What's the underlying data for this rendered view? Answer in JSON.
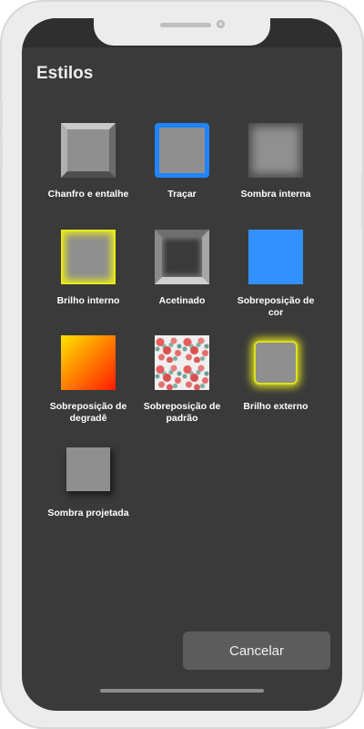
{
  "header": {
    "title": "Estilos"
  },
  "styles": [
    {
      "label": "Chanfro e entalhe"
    },
    {
      "label": "Traçar"
    },
    {
      "label": "Sombra interna"
    },
    {
      "label": "Brilho interno"
    },
    {
      "label": "Acetinado"
    },
    {
      "label": "Sobreposição de cor"
    },
    {
      "label": "Sobreposição de degradê"
    },
    {
      "label": "Sobreposição de padrão"
    },
    {
      "label": "Brilho externo"
    },
    {
      "label": "Sombra projetada"
    }
  ],
  "footer": {
    "cancel_label": "Cancelar"
  },
  "colors": {
    "accent": "#1e84ff",
    "screen_bg": "#3a3a3a",
    "button_bg": "#5c5c5c",
    "glow": "#e3e61f"
  }
}
